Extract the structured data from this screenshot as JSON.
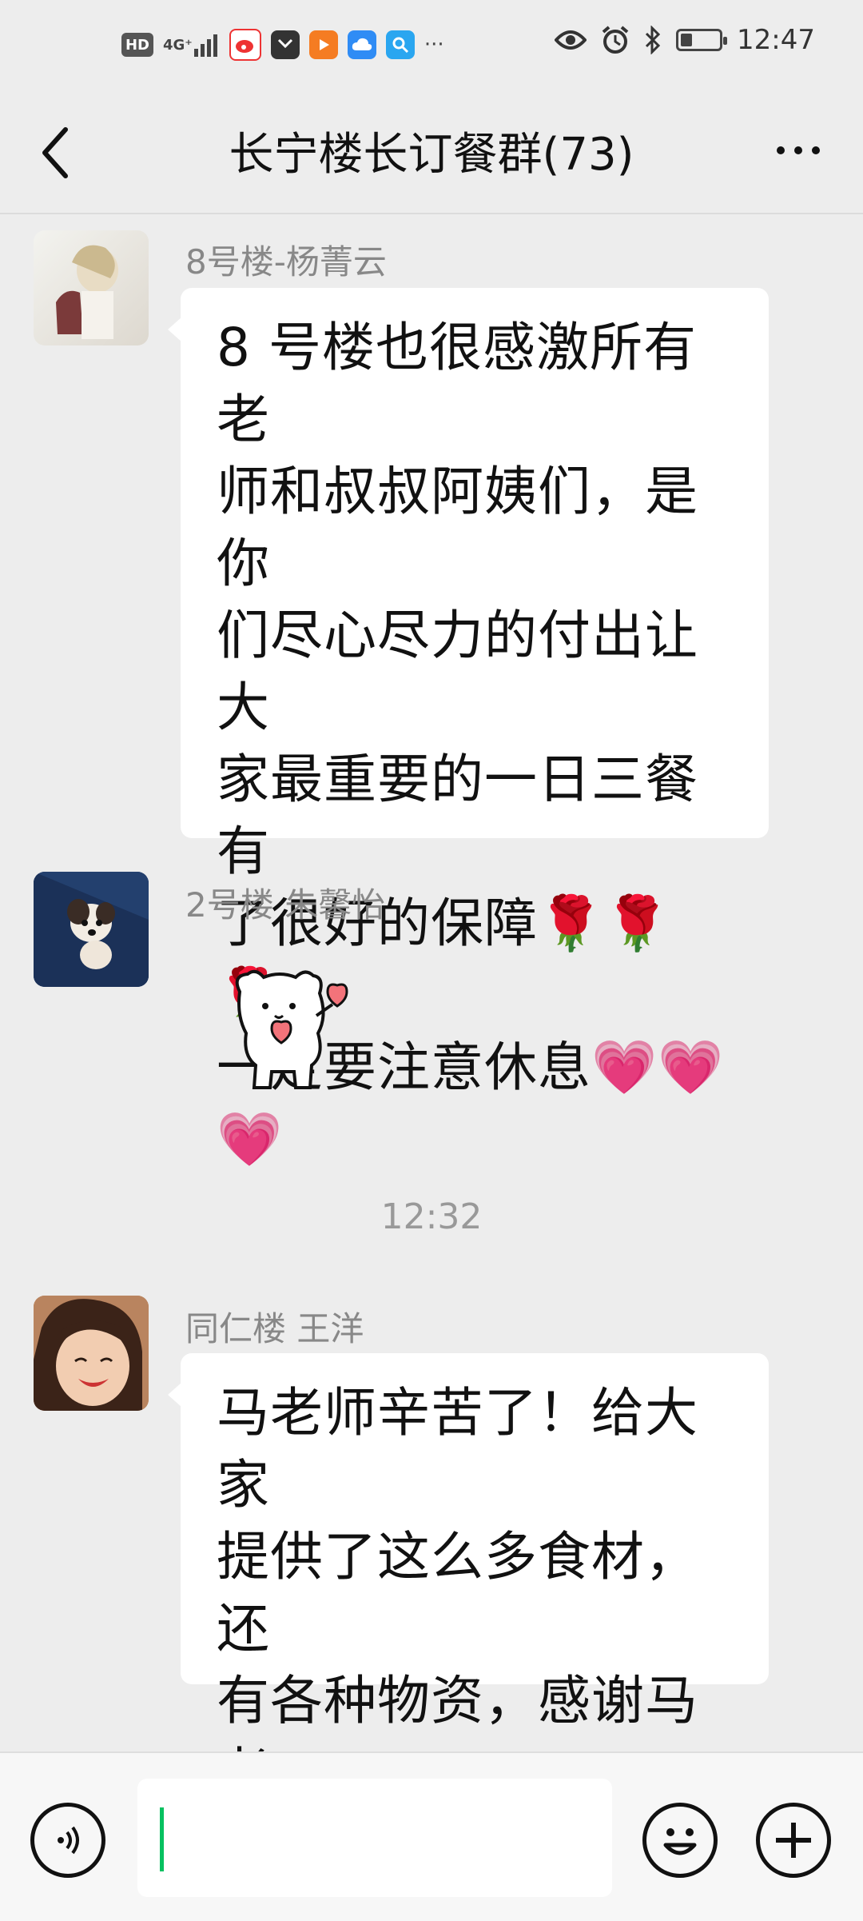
{
  "status_bar": {
    "hd": "HD",
    "signal": "4G⁺",
    "ellipsis": "···",
    "time": "12:47",
    "icons": [
      "hd-icon",
      "signal-icon",
      "weibo-icon",
      "huawei-icon",
      "video-icon",
      "cloud-icon",
      "search-icon",
      "eye-icon",
      "alarm-icon",
      "bluetooth-icon",
      "battery-icon"
    ],
    "battery_level": 0.3
  },
  "header": {
    "title": "长宁楼长订餐群(73)"
  },
  "messages": [
    {
      "sender": "8号楼-杨菁云",
      "text": "8 号楼也很感激所有老\n师和叔叔阿姨们，是你\n们尽心尽力的付出让大\n家最重要的一日三餐有\n了很好的保障🌹🌹🌹\n一定要注意休息💗💗\n💗"
    },
    {
      "sender": "2号楼 朱馨怡",
      "sticker": "bear-heart-sticker"
    },
    {
      "timestamp": "12:32"
    },
    {
      "sender": "同仁楼 王洋",
      "text": "马老师辛苦了！给大家\n提供了这么多食材，还\n有各种物资，感谢马老\n师🌹🌹🌹"
    }
  ],
  "input_bar": {
    "value": "",
    "icons": [
      "voice-icon",
      "emoji-icon",
      "plus-icon"
    ]
  },
  "colors": {
    "background": "#ededed",
    "bubble": "#ffffff",
    "accent": "#07c160"
  }
}
